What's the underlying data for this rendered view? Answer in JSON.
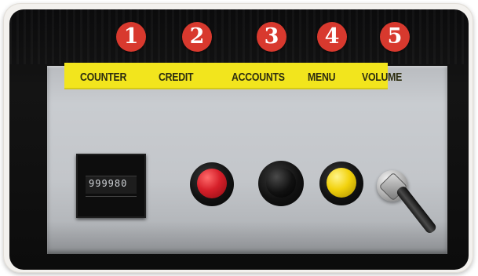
{
  "controls": [
    {
      "number": "1",
      "label": "COUNTER"
    },
    {
      "number": "2",
      "label": "CREDIT"
    },
    {
      "number": "3",
      "label": "ACCOUNTS"
    },
    {
      "number": "4",
      "label": "MENU"
    },
    {
      "number": "5",
      "label": "VOLUME"
    }
  ],
  "counter": {
    "digits": "999980"
  },
  "colors": {
    "badge": "#d8392e",
    "label_strip": "#f2e51d",
    "credit_button": "#d6202a",
    "accounts_button": "#111111",
    "menu_button": "#f2d20d"
  }
}
